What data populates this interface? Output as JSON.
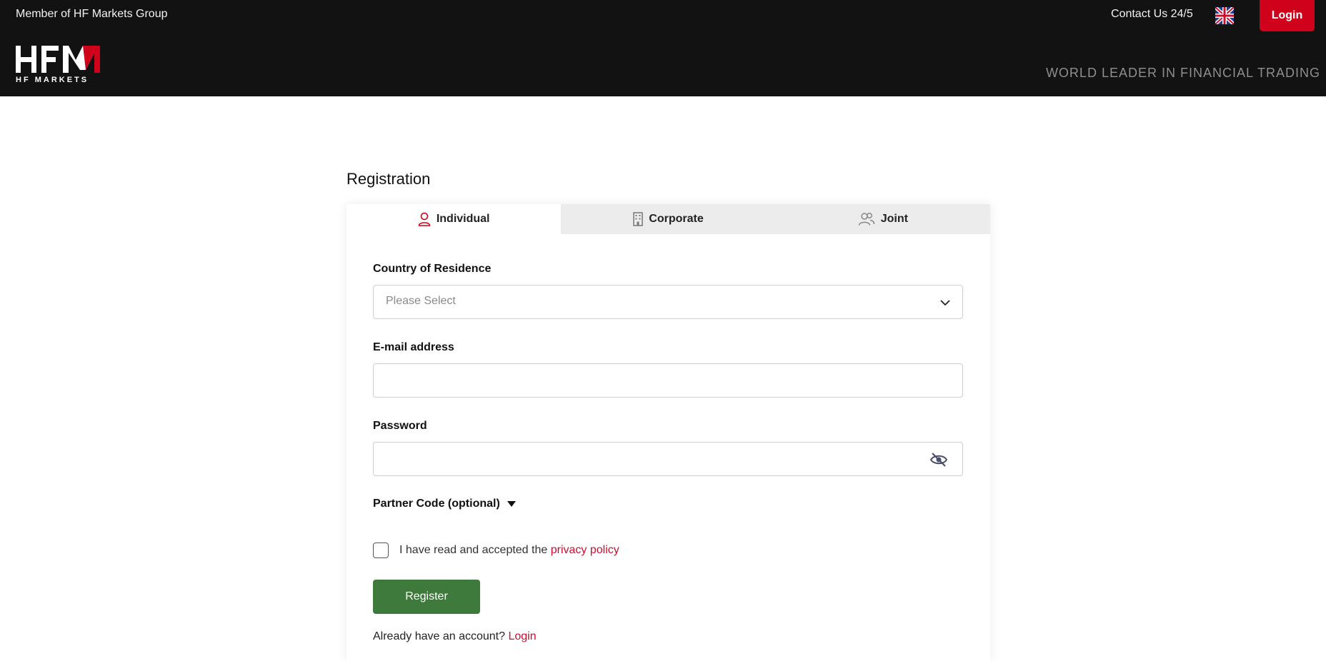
{
  "header": {
    "member_text": "Member of HF Markets Group",
    "contact_text": "Contact Us 24/5",
    "login_label": "Login",
    "logo_text": "HFM",
    "logo_sub": "HF MARKETS",
    "tagline": "WORLD LEADER IN FINANCIAL TRADING",
    "language_icon": "uk-flag-icon"
  },
  "registration": {
    "title": "Registration",
    "tabs": [
      {
        "label": "Individual",
        "icon": "user-icon",
        "active": true
      },
      {
        "label": "Corporate",
        "icon": "building-icon",
        "active": false
      },
      {
        "label": "Joint",
        "icon": "users-icon",
        "active": false
      }
    ],
    "country_label": "Country of Residence",
    "country_placeholder": "Please Select",
    "email_label": "E-mail address",
    "email_value": "",
    "password_label": "Password",
    "password_value": "",
    "partner_label": "Partner Code (optional)",
    "policy_prefix": "I have read and accepted the ",
    "policy_link": "privacy policy",
    "register_label": "Register",
    "already_text": "Already have an account? ",
    "already_link": "Login"
  },
  "colors": {
    "header_bg": "#121212",
    "brand_red": "#d0021b",
    "register_green": "#3f7a3d",
    "link_red": "#c8102e"
  }
}
